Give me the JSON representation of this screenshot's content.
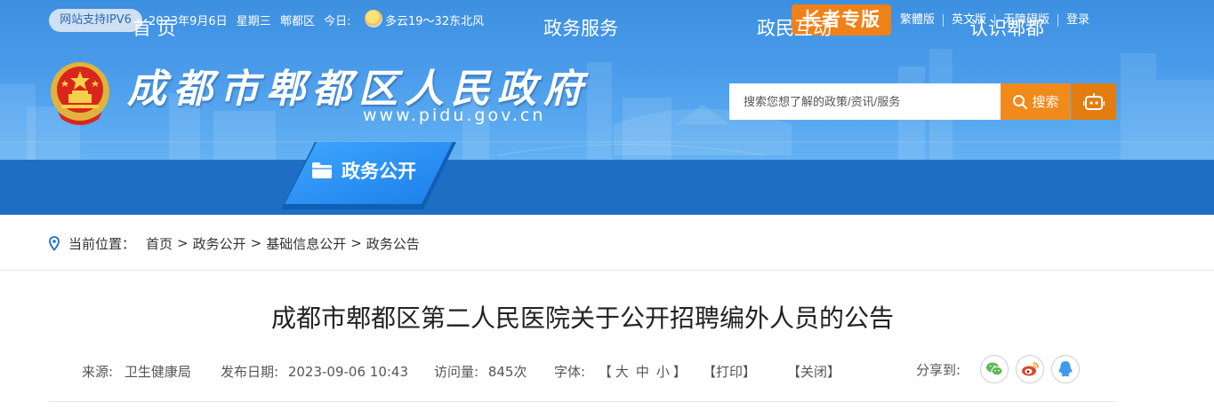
{
  "topbar": {
    "ipv6_badge": "网站支持IPV6",
    "date": "2023年9月6日",
    "weekday": "星期三",
    "district": "郫都区",
    "today_label": "今日:",
    "weather": "多云19～32东北风",
    "elder_mode": "长者专版",
    "links": [
      "繁體版",
      "英文版",
      "无障碍版",
      "登录"
    ]
  },
  "header": {
    "site_title": "成都市郫都区人民政府",
    "site_url": "www.pidu.gov.cn",
    "search_placeholder": "搜索您想了解的政策/资讯/服务",
    "search_button": "搜索"
  },
  "nav": {
    "items": [
      "首 页",
      "政务公开",
      "政务服务",
      "政民互动",
      "认识郫都"
    ],
    "active": "政务公开"
  },
  "breadcrumb": {
    "label": "当前位置：",
    "items": [
      "首页",
      "政务公开",
      "基础信息公开",
      "政务公告"
    ],
    "separator": ">"
  },
  "article": {
    "title": "成都市郫都区第二人民医院关于公开招聘编外人员的公告",
    "source_label": "来源:",
    "source": "卫生健康局",
    "date_label": "发布日期:",
    "date": "2023-09-06 10:43",
    "views_label": "访问量:",
    "views": "845次",
    "font_label": "字体:",
    "font_size_open": "【",
    "font_large": "大",
    "font_medium": "中",
    "font_small": "小",
    "font_size_close": "】",
    "print": "【打印】",
    "close": "【关闭】",
    "share_label": "分享到:"
  },
  "colors": {
    "nav_bg": "#1e6fc4",
    "accent_orange": "#f08119",
    "banner_blue": "#4a9ceb",
    "wechat": "#5bb85c",
    "weibo": "#e0452b",
    "qq": "#3d9be9"
  },
  "icons": [
    "weather-sunny-cloud-icon",
    "national-emblem-icon",
    "search-icon",
    "robot-icon",
    "folder-icon",
    "location-pin-icon",
    "wechat-icon",
    "weibo-icon",
    "qq-icon"
  ]
}
